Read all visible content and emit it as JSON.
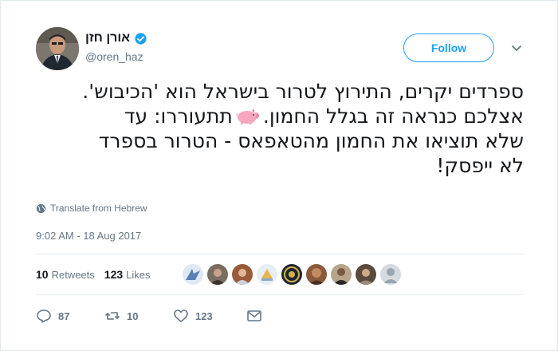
{
  "author": {
    "name": "אורן חזן",
    "handle": "@oren_haz",
    "verified": true
  },
  "follow_label": "Follow",
  "tweet": {
    "lines": [
      "ספרדים יקרים, התירוץ לטרור בישראל הוא 'הכיבוש'.",
      "אצלכם כנראה זה בגלל החמון.",
      "תתעוררו: עד",
      "שלא תוציאו את החמון מהטאפאס - הטרור בספרד",
      "לא ייפסק!"
    ],
    "emoji": "pig-icon"
  },
  "translate_label": "Translate from Hebrew",
  "timestamp": "9:02 AM - 18 Aug 2017",
  "stats": {
    "retweets_count": "10",
    "retweets_label": "Retweets",
    "likes_count": "123",
    "likes_label": "Likes"
  },
  "actions": {
    "replies": "87",
    "retweets": "10",
    "likes": "123"
  },
  "colors": {
    "accent": "#1da1f2",
    "muted": "#657786",
    "border": "#e6ecf0"
  }
}
